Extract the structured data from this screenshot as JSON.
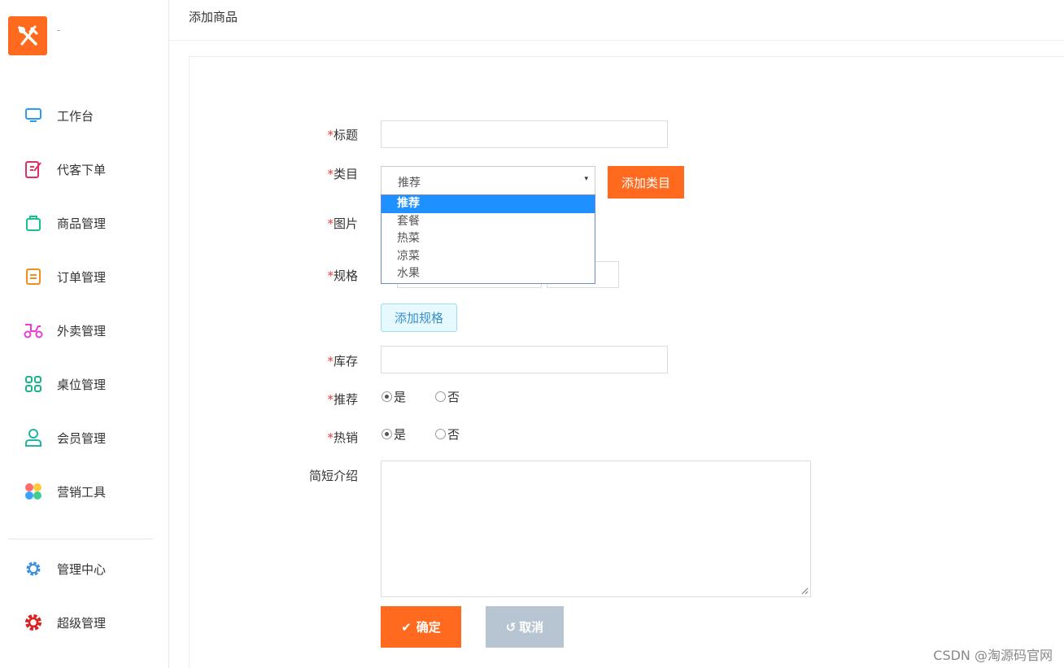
{
  "app": {
    "logo_text": "-"
  },
  "sidebar": {
    "items": [
      {
        "label": "工作台",
        "icon": "monitor-icon",
        "color": "#2e9af0"
      },
      {
        "label": "代客下单",
        "icon": "edit-note-icon",
        "color": "#e0305f"
      },
      {
        "label": "商品管理",
        "icon": "bag-icon",
        "color": "#13c28c"
      },
      {
        "label": "订单管理",
        "icon": "order-list-icon",
        "color": "#f58e1c"
      },
      {
        "label": "外卖管理",
        "icon": "scooter-icon",
        "color": "#e93cd8"
      },
      {
        "label": "桌位管理",
        "icon": "grid-icon",
        "color": "#19b58a"
      },
      {
        "label": "会员管理",
        "icon": "user-icon",
        "color": "#1fb5a7"
      },
      {
        "label": "营销工具",
        "icon": "palette-icon",
        "color": "#ff6a6a"
      }
    ],
    "bottom_items": [
      {
        "label": "管理中心",
        "icon": "gear-icon",
        "color": "#3d8fe0"
      },
      {
        "label": "超级管理",
        "icon": "gear-icon",
        "color": "#e02020"
      }
    ]
  },
  "header": {
    "title": "添加商品"
  },
  "form": {
    "required_mark": "*",
    "title_label": "标题",
    "title_value": "",
    "category_label": "类目",
    "category_value": "推荐",
    "category_options": [
      "推荐",
      "套餐",
      "热菜",
      "凉菜",
      "水果"
    ],
    "add_category_button": "添加类目",
    "image_label": "图片",
    "spec_label": "规格",
    "add_spec_button": "添加规格",
    "stock_label": "库存",
    "stock_value": "",
    "recommend_label": "推荐",
    "hot_label": "热销",
    "yes_label": "是",
    "no_label": "否",
    "recommend_value": "是",
    "hot_value": "是",
    "intro_label": "简短介绍",
    "intro_value": "",
    "confirm_button": "确定",
    "cancel_button": "取消"
  },
  "watermark": "CSDN @淘源码官网"
}
